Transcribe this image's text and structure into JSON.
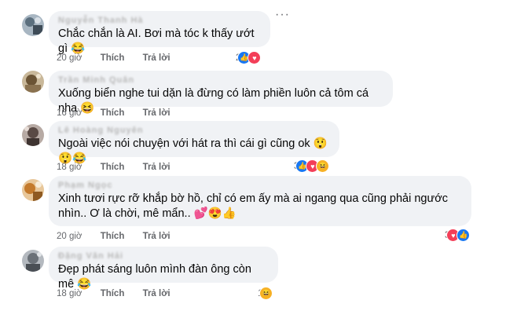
{
  "labels": {
    "like": "Thích",
    "reply": "Trả lời"
  },
  "comments": [
    {
      "name": "Nguyễn Thanh Hà",
      "text": "Chắc chắn là AI. Bơi mà tóc k thấy ướt gì 😂",
      "time": "20 giờ",
      "reaction_count": "2",
      "reaction_icons": [
        "like-icon",
        "love-icon"
      ],
      "more_label": "···"
    },
    {
      "name": "Trần Minh Quân",
      "text": "Xuống biển nghe tui dặn là đừng có làm phiền luôn cả tôm cá nha 😆",
      "time": "16 giờ",
      "reaction_count": "",
      "reaction_icons": []
    },
    {
      "name": "Lê Hoàng Nguyên",
      "text": "Ngoài việc nói chuyện với hát ra thì cái gì cũng ok 😲😲😂",
      "time": "18 giờ",
      "reaction_count": "3",
      "reaction_icons": [
        "like-icon",
        "love-icon",
        "haha-icon"
      ]
    },
    {
      "name": "Phạm Ngọc",
      "text": "Xinh tươi rực rỡ khắp bờ hồ, chỉ có em ấy mà ai ngang qua cũng phải ngước nhìn.. Ơ là chời, mê mẩn.. 💕😍👍",
      "time": "20 giờ",
      "reaction_count": "3",
      "reaction_icons": [
        "love-icon",
        "like-icon"
      ]
    },
    {
      "name": "Đặng Văn Hải",
      "text": "Đẹp phát sáng luôn mình đàn ông còn mê 😂",
      "time": "18 giờ",
      "reaction_count": "1",
      "reaction_icons": [
        "haha-icon"
      ]
    }
  ]
}
